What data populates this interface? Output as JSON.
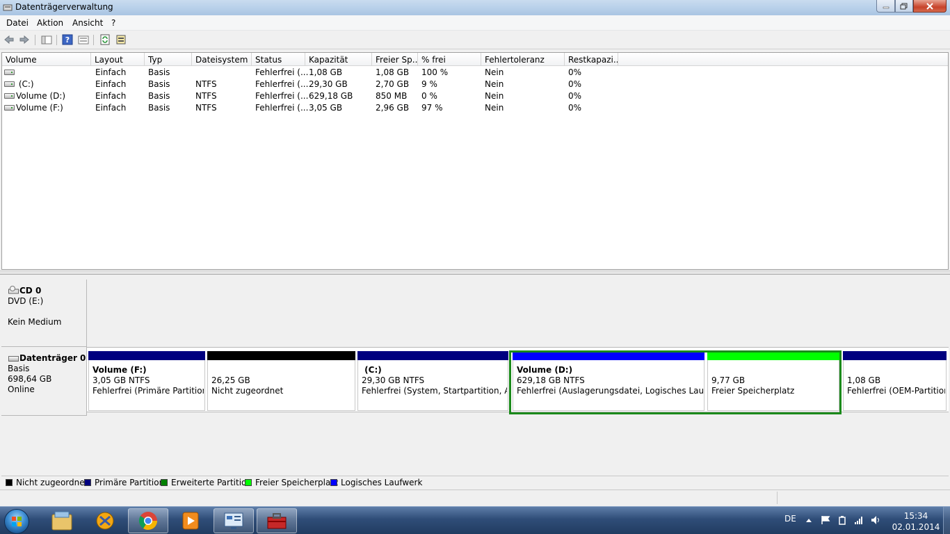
{
  "window": {
    "title": "Datenträgerverwaltung"
  },
  "menu": [
    "Datei",
    "Aktion",
    "Ansicht",
    "?"
  ],
  "toolbar": {
    "icons": [
      "back-arrow-icon",
      "forward-arrow-icon",
      "show-hide-console-tree-icon",
      "help-icon",
      "properties-icon",
      "refresh-icon",
      "rescan-disks-icon"
    ]
  },
  "volume_list": {
    "columns": [
      "Volume",
      "Layout",
      "Typ",
      "Dateisystem",
      "Status",
      "Kapazität",
      "Freier Sp...",
      "% frei",
      "Fehlertoleranz",
      "Restkapazi..."
    ],
    "rows": [
      [
        "",
        "Einfach",
        "Basis",
        "",
        "Fehlerfrei (...",
        "1,08 GB",
        "1,08 GB",
        "100 %",
        "Nein",
        "0%"
      ],
      [
        " (C:)",
        "Einfach",
        "Basis",
        "NTFS",
        "Fehlerfrei (...",
        "29,30 GB",
        "2,70 GB",
        "9 %",
        "Nein",
        "0%"
      ],
      [
        "Volume (D:)",
        "Einfach",
        "Basis",
        "NTFS",
        "Fehlerfrei (...",
        "629,18 GB",
        "850 MB",
        "0 %",
        "Nein",
        "0%"
      ],
      [
        "Volume (F:)",
        "Einfach",
        "Basis",
        "NTFS",
        "Fehlerfrei (...",
        "3,05 GB",
        "2,96 GB",
        "97 %",
        "Nein",
        "0%"
      ]
    ]
  },
  "cd0": {
    "name": "CD 0",
    "type": "DVD (E:)",
    "status": "Kein Medium"
  },
  "disk0": {
    "name": "Datenträger 0",
    "type": "Basis",
    "size": "698,64 GB",
    "status": "Online",
    "partitions": [
      {
        "name": "Volume  (F:)",
        "size": "3,05 GB NTFS",
        "status": "Fehlerfrei (Primäre Partition)",
        "color": "#00007f"
      },
      {
        "name": "",
        "size": "26,25 GB",
        "status": "Nicht zugeordnet",
        "color": "#000000"
      },
      {
        "name": " (C:)",
        "size": "29,30 GB NTFS",
        "status": "Fehlerfrei (System, Startpartition, Aktiv,",
        "color": "#00007f"
      },
      {
        "name": "Volume  (D:)",
        "size": "629,18 GB NTFS",
        "status": "Fehlerfrei (Auslagerungsdatei, Logisches Laufwerk",
        "color": "#0000ff"
      },
      {
        "name": "",
        "size": "9,77 GB",
        "status": "Freier Speicherplatz",
        "color": "#00ff00"
      },
      {
        "name": "",
        "size": "1,08 GB",
        "status": "Fehlerfrei (OEM-Partition)",
        "color": "#00007f"
      }
    ]
  },
  "legend": [
    {
      "label": "Nicht zugeordnet",
      "color": "#000000"
    },
    {
      "label": "Primäre Partition",
      "color": "#00007f"
    },
    {
      "label": "Erweiterte Partition",
      "color": "#008000"
    },
    {
      "label": "Freier Speicherplatz",
      "color": "#00ff00"
    },
    {
      "label": "Logisches Laufwerk",
      "color": "#0000ff"
    }
  ],
  "taskbar": {
    "apps": [
      "windows-explorer-icon",
      "tools-app-icon",
      "chrome-icon",
      "media-player-icon",
      "control-panel-icon",
      "toolbox-icon"
    ],
    "language": "DE",
    "time": "15:34",
    "date": "02.01.2014"
  }
}
